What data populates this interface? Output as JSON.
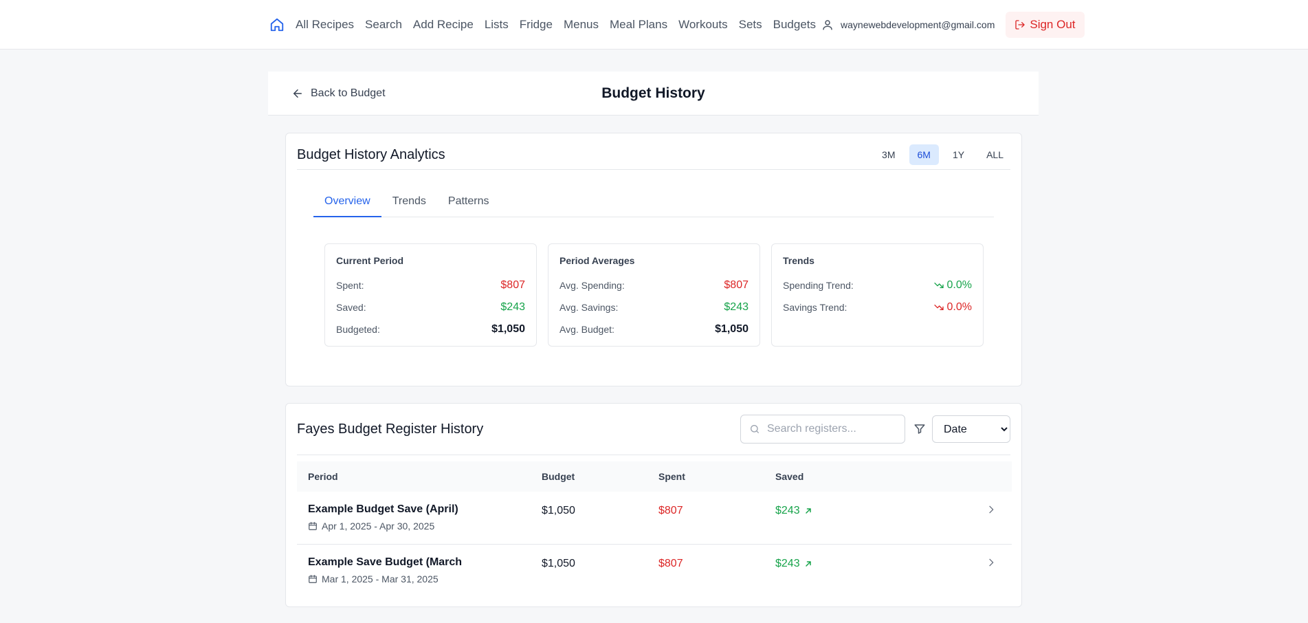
{
  "nav": {
    "items": [
      {
        "label": "All Recipes"
      },
      {
        "label": "Search"
      },
      {
        "label": "Add Recipe"
      },
      {
        "label": "Lists"
      },
      {
        "label": "Fridge"
      },
      {
        "label": "Menus"
      },
      {
        "label": "Meal Plans"
      },
      {
        "label": "Workouts"
      },
      {
        "label": "Sets"
      },
      {
        "label": "Budgets"
      }
    ],
    "user_email": "waynewebdevelopment@gmail.com",
    "signout_label": "Sign Out",
    "icons": {
      "home": "home-icon",
      "user": "user-icon",
      "signout": "log-out-icon"
    },
    "accent_color": "#2563eb"
  },
  "header": {
    "back_label": "Back to Budget",
    "title": "Budget History"
  },
  "analytics": {
    "title": "Budget History Analytics",
    "ranges": [
      {
        "label": "3M",
        "active": false
      },
      {
        "label": "6M",
        "active": true
      },
      {
        "label": "1Y",
        "active": false
      },
      {
        "label": "ALL",
        "active": false
      }
    ],
    "tabs": [
      {
        "label": "Overview",
        "active": true
      },
      {
        "label": "Trends",
        "active": false
      },
      {
        "label": "Patterns",
        "active": false
      }
    ],
    "current_period": {
      "title": "Current Period",
      "rows": [
        {
          "label": "Spent:",
          "value": "$807"
        },
        {
          "label": "Saved:",
          "value": "$243"
        },
        {
          "label": "Budgeted:",
          "value": "$1,050"
        }
      ]
    },
    "period_averages": {
      "title": "Period Averages",
      "rows": [
        {
          "label": "Avg. Spending:",
          "value": "$807"
        },
        {
          "label": "Avg. Savings:",
          "value": "$243"
        },
        {
          "label": "Avg. Budget:",
          "value": "$1,050"
        }
      ]
    },
    "trends": {
      "title": "Trends",
      "rows": [
        {
          "label": "Spending Trend:",
          "value": "0.0%",
          "icon": "trending-down-icon",
          "color": "#16a34a"
        },
        {
          "label": "Savings Trend:",
          "value": "0.0%",
          "icon": "trending-down-icon",
          "color": "#dc2626"
        }
      ]
    }
  },
  "history": {
    "title": "Fayes Budget Register History",
    "search_placeholder": "Search registers...",
    "sort_value": "Date",
    "columns": [
      "Period",
      "Budget",
      "Spent",
      "Saved"
    ],
    "rows": [
      {
        "name": "Example Budget Save (April)",
        "dates": "Apr 1, 2025 - Apr 30, 2025",
        "budget": "$1,050",
        "spent": "$807",
        "saved": "$243"
      },
      {
        "name": "Example Save Budget (March",
        "dates": "Mar 1, 2025 - Mar 31, 2025",
        "budget": "$1,050",
        "spent": "$807",
        "saved": "$243"
      }
    ]
  },
  "colors": {
    "spent": "#dc2626",
    "saved": "#16a34a",
    "signout_bg": "#fef2f2"
  }
}
